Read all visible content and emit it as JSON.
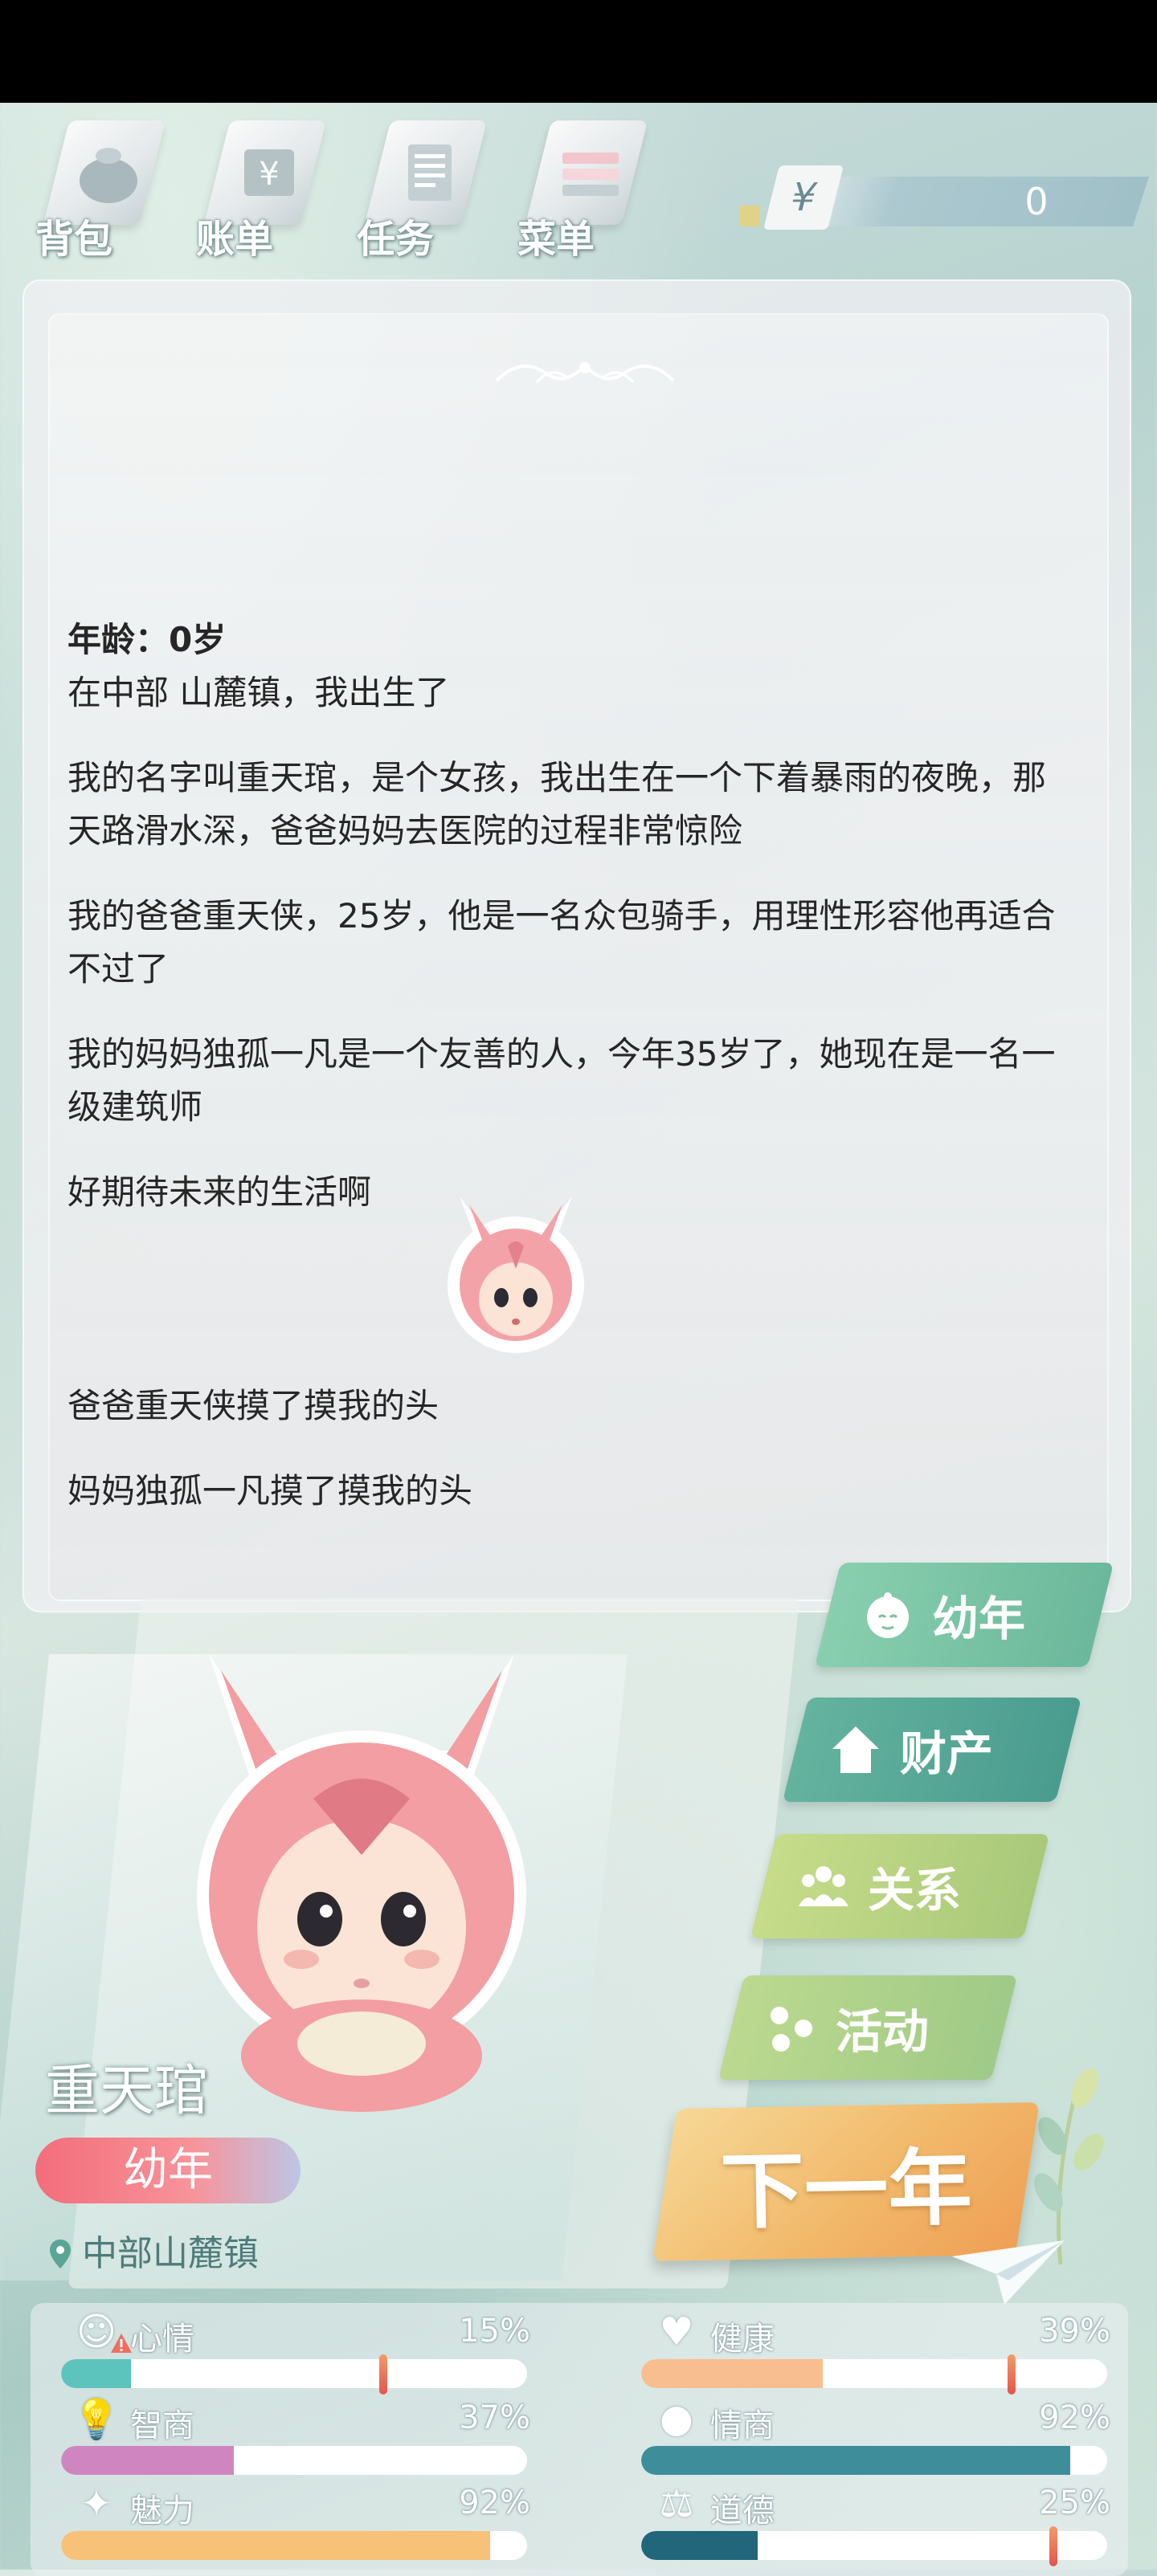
{
  "nav": {
    "items": [
      {
        "label": "背包",
        "icon": "bag-icon"
      },
      {
        "label": "账单",
        "icon": "bill-icon"
      },
      {
        "label": "任务",
        "icon": "task-icon"
      },
      {
        "label": "菜单",
        "icon": "menu-icon"
      }
    ],
    "currency_symbol": "¥",
    "money": "0"
  },
  "story": {
    "age_line": "年龄：0岁",
    "paragraphs": [
      "在中部 山麓镇，我出生了",
      "我的名字叫重天琯，是个女孩，我出生在一个下着暴雨的夜晚，那天路滑水深，爸爸妈妈去医院的过程非常惊险",
      "我的爸爸重天侠，25岁，他是一名众包骑手，用理性形容他再适合不过了",
      "我的妈妈独孤一凡是一个友善的人，今年35岁了，她现在是一名一级建筑师",
      "好期待未来的生活啊"
    ],
    "events": [
      "爸爸重天侠摸了摸我的头",
      "妈妈独孤一凡摸了摸我的头"
    ]
  },
  "character": {
    "name": "重天琯",
    "stage": "幼年",
    "location": "中部山麓镇"
  },
  "menu": {
    "childhood": "幼年",
    "property": "财产",
    "relations": "关系",
    "activities": "活动",
    "next_year": "下一年"
  },
  "stats": {
    "mood": {
      "label": "心情",
      "pct": "15%",
      "value": 0.15,
      "color": "#5cc3bd",
      "warning": true
    },
    "health": {
      "label": "健康",
      "pct": "39%",
      "value": 0.39,
      "color": "#f8be8f"
    },
    "iq": {
      "label": "智商",
      "pct": "37%",
      "value": 0.37,
      "color": "#cf86c0"
    },
    "eq": {
      "label": "情商",
      "pct": "92%",
      "value": 0.92,
      "color": "#3d8e9a"
    },
    "charm": {
      "label": "魅力",
      "pct": "92%",
      "value": 0.92,
      "color": "#f7c178"
    },
    "morality": {
      "label": "道德",
      "pct": "25%",
      "value": 0.25,
      "color": "#21667a"
    }
  },
  "colors": {
    "accent_pink": "#f36d7b",
    "menu_green": "#7ac6a6",
    "next_year_orange": "#f2b96b"
  }
}
